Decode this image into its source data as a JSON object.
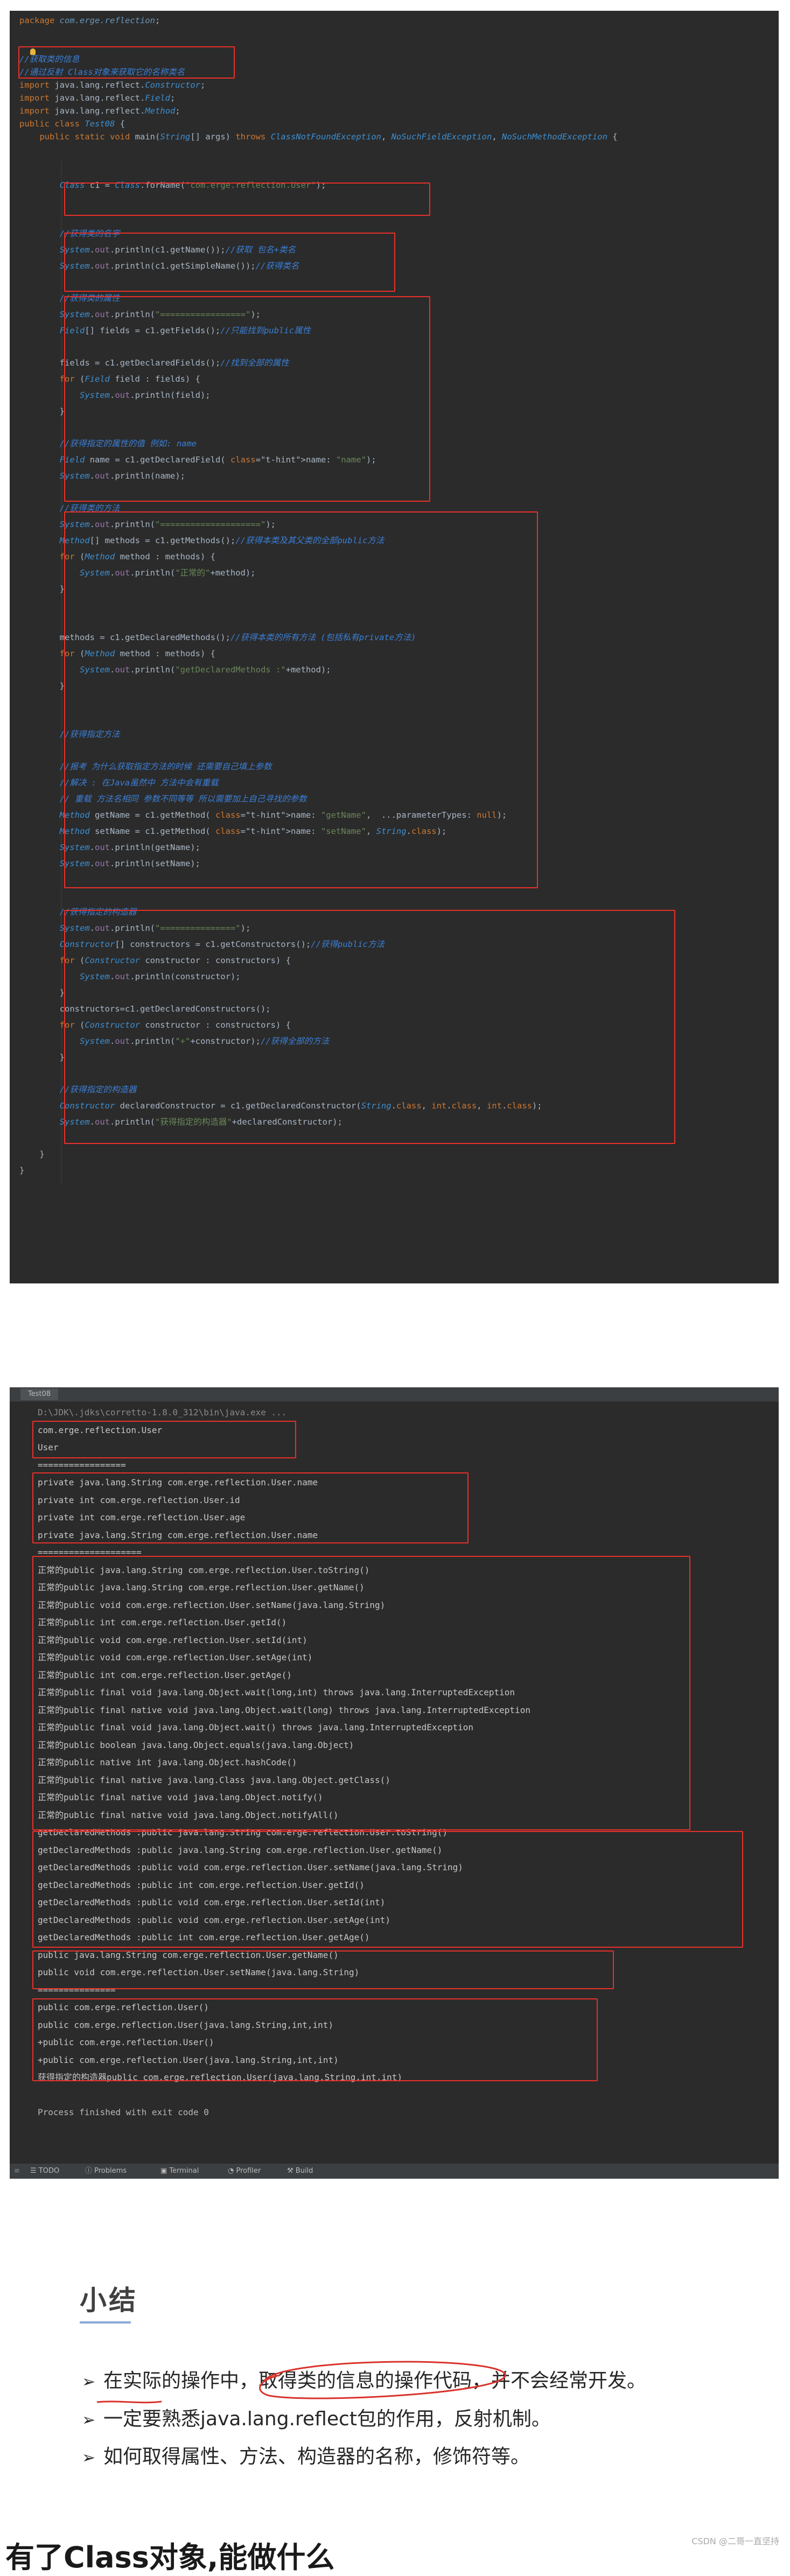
{
  "editor": {
    "lines": [
      "package com.erge.reflection;",
      "",
      "",
      "//获取类的信息",
      "//通过反射 Class对象来获取它的名称类名",
      "import java.lang.reflect.Constructor;",
      "import java.lang.reflect.Field;",
      "import java.lang.reflect.Method;",
      "public class Test08 {",
      "    public static void main(String[] args) throws ClassNotFoundException, NoSuchFieldException, NoSuchMethodException {",
      "",
      "",
      "        Class c1 = Class.forName(\"com.erge.reflection.User\");",
      "",
      "",
      "        //获得类的名字",
      "        System.out.println(c1.getName());//获取 包名+类名",
      "        System.out.println(c1.getSimpleName());//获得类名",
      "",
      "        //获得类的属性",
      "        System.out.println(\"=================\");",
      "        Field[] fields = c1.getFields();//只能找到public属性",
      "",
      "        fields = c1.getDeclaredFields();//找到全部的属性",
      "        for (Field field : fields) {",
      "            System.out.println(field);",
      "        }",
      "",
      "        //获得指定的属性的值 例如: name",
      "        Field name = c1.getDeclaredField( name: \"name\");",
      "        System.out.println(name);",
      "",
      "        //获得类的方法",
      "        System.out.println(\"====================\");",
      "        Method[] methods = c1.getMethods();//获得本类及其父类的全部public方法",
      "        for (Method method : methods) {",
      "            System.out.println(\"正常的\"+method);",
      "        }",
      "",
      "",
      "        methods = c1.getDeclaredMethods();//获得本类的所有方法 (包括私有private方法)",
      "        for (Method method : methods) {",
      "            System.out.println(\"getDeclaredMethods :\"+method);",
      "        }",
      "",
      "",
      "        //获得指定方法",
      "",
      "        //报考 为什么获取指定方法的时候 还需要自己填上参数",
      "        //解决 : 在Java虽然中 方法中会有重载",
      "        // 重载 方法名相同 参数不同等等 所以需要加上自己寻找的参数",
      "        Method getName = c1.getMethod( name: \"getName\",  ...parameterTypes: null);",
      "        Method setName = c1.getMethod( name: \"setName\", String.class);",
      "        System.out.println(getName);",
      "        System.out.println(setName);",
      "",
      "",
      "        //获得指定的构造器",
      "        System.out.println(\"===============\");",
      "        Constructor[] constructors = c1.getConstructors();//获得public方法",
      "        for (Constructor constructor : constructors) {",
      "            System.out.println(constructor);",
      "        }",
      "        constructors=c1.getDeclaredConstructors();",
      "        for (Constructor constructor : constructors) {",
      "            System.out.println(\"+\"+constructor);//获得全部的方法",
      "        }",
      "",
      "        //获得指定的构造器",
      "        Constructor declaredConstructor = c1.getDeclaredConstructor(String.class, int.class, int.class);",
      "        System.out.println(\"获得指定的构造器\"+declaredConstructor);",
      "",
      "    }",
      "}"
    ]
  },
  "console": {
    "tab_label": "Test08",
    "lines": [
      "D:\\JDK\\.jdks\\corretto-1.8.0_312\\bin\\java.exe ...",
      "com.erge.reflection.User",
      "User",
      "=================",
      "private java.lang.String com.erge.reflection.User.name",
      "private int com.erge.reflection.User.id",
      "private int com.erge.reflection.User.age",
      "private java.lang.String com.erge.reflection.User.name",
      "====================",
      "正常的public java.lang.String com.erge.reflection.User.toString()",
      "正常的public java.lang.String com.erge.reflection.User.getName()",
      "正常的public void com.erge.reflection.User.setName(java.lang.String)",
      "正常的public int com.erge.reflection.User.getId()",
      "正常的public void com.erge.reflection.User.setId(int)",
      "正常的public void com.erge.reflection.User.setAge(int)",
      "正常的public int com.erge.reflection.User.getAge()",
      "正常的public final void java.lang.Object.wait(long,int) throws java.lang.InterruptedException",
      "正常的public final native void java.lang.Object.wait(long) throws java.lang.InterruptedException",
      "正常的public final void java.lang.Object.wait() throws java.lang.InterruptedException",
      "正常的public boolean java.lang.Object.equals(java.lang.Object)",
      "正常的public native int java.lang.Object.hashCode()",
      "正常的public final native java.lang.Class java.lang.Object.getClass()",
      "正常的public final native void java.lang.Object.notify()",
      "正常的public final native void java.lang.Object.notifyAll()",
      "getDeclaredMethods :public java.lang.String com.erge.reflection.User.toString()",
      "getDeclaredMethods :public java.lang.String com.erge.reflection.User.getName()",
      "getDeclaredMethods :public void com.erge.reflection.User.setName(java.lang.String)",
      "getDeclaredMethods :public int com.erge.reflection.User.getId()",
      "getDeclaredMethods :public void com.erge.reflection.User.setId(int)",
      "getDeclaredMethods :public void com.erge.reflection.User.setAge(int)",
      "getDeclaredMethods :public int com.erge.reflection.User.getAge()",
      "public java.lang.String com.erge.reflection.User.getName()",
      "public void com.erge.reflection.User.setName(java.lang.String)",
      "===============",
      "public com.erge.reflection.User()",
      "public com.erge.reflection.User(java.lang.String,int,int)",
      "+public com.erge.reflection.User()",
      "+public com.erge.reflection.User(java.lang.String,int,int)",
      "获得指定的构造器public com.erge.reflection.User(java.lang.String,int,int)",
      "",
      "Process finished with exit code 0"
    ],
    "bottom_items": [
      "TODO",
      "Problems",
      "Terminal",
      "Profiler",
      "Build"
    ]
  },
  "slide": {
    "title": "小结",
    "bullets": [
      "在实际的操作中，取得类的信息的操作代码，并不会经常开发。",
      "一定要熟悉java.lang.reflect包的作用，反射机制。",
      "如何取得属性、方法、构造器的名称，修饰符等。"
    ],
    "next_heading": "有了Class对象,能做什么",
    "watermark": "CSDN @二哥一直坚持"
  },
  "colors": {
    "editor_bg": "#2b2b2b",
    "highlight_box": "#e8302a",
    "accent_underline": "#8aa9d6"
  }
}
